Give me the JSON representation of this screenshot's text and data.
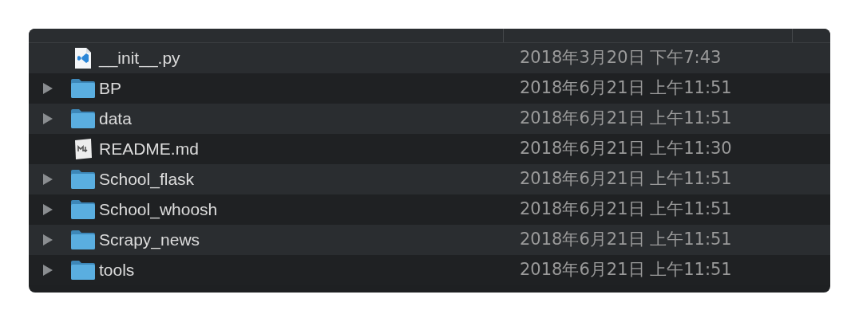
{
  "rows": [
    {
      "kind": "python",
      "name": "__init__.py",
      "modified": "2018年3月20日 下午7:43"
    },
    {
      "kind": "folder",
      "expanded": false,
      "name": "BP",
      "modified": "2018年6月21日 上午11:51"
    },
    {
      "kind": "folder",
      "expanded": false,
      "name": "data",
      "modified": "2018年6月21日 上午11:51"
    },
    {
      "kind": "markdown",
      "name": "README.md",
      "modified": "2018年6月21日 上午11:30"
    },
    {
      "kind": "folder",
      "expanded": false,
      "name": "School_flask",
      "modified": "2018年6月21日 上午11:51"
    },
    {
      "kind": "folder",
      "expanded": false,
      "name": "School_whoosh",
      "modified": "2018年6月21日 上午11:51"
    },
    {
      "kind": "folder",
      "expanded": false,
      "name": "Scrapy_news",
      "modified": "2018年6月21日 上午11:51"
    },
    {
      "kind": "folder",
      "expanded": false,
      "name": "tools",
      "modified": "2018年6月21日 上午11:51"
    }
  ]
}
